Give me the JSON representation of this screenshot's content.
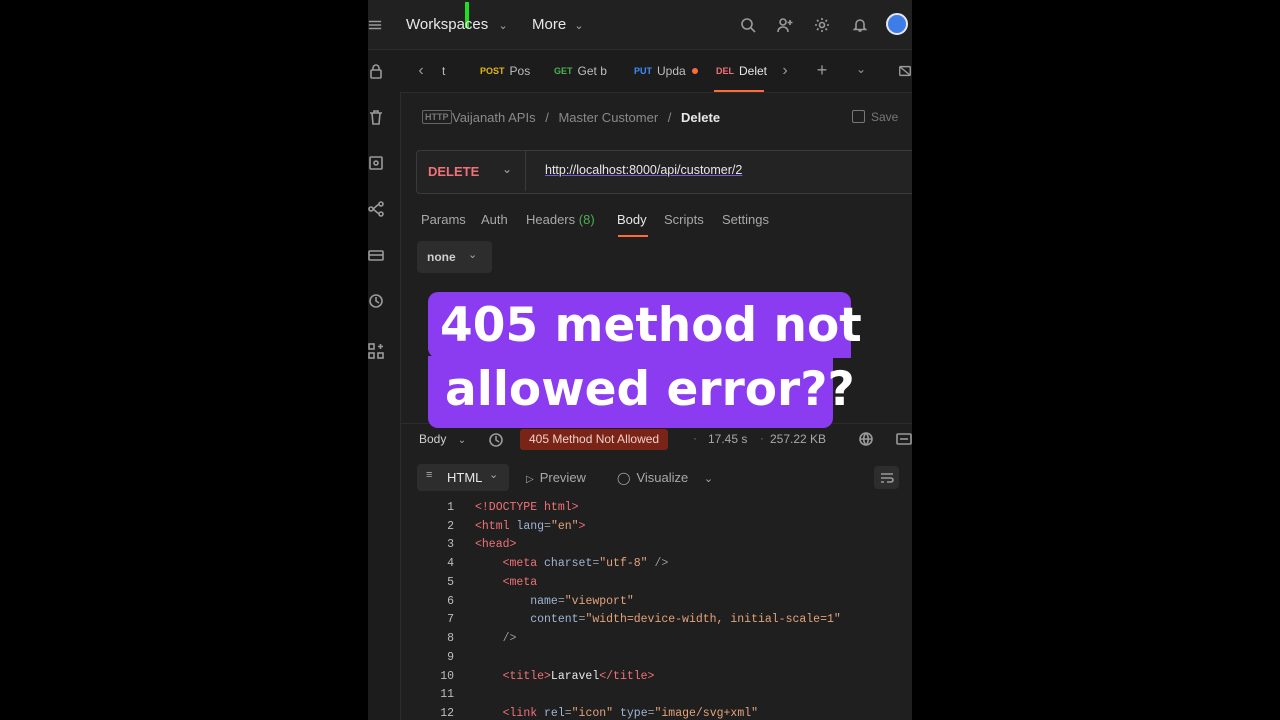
{
  "topbar": {
    "workspaces_label": "Workspaces",
    "more_label": "More"
  },
  "tabs": [
    {
      "method": "",
      "label": "t"
    },
    {
      "method": "POST",
      "label": "Pos"
    },
    {
      "method": "GET",
      "label": "Get b"
    },
    {
      "method": "PUT",
      "label": "Upda"
    },
    {
      "method": "DEL",
      "label": "Delet"
    }
  ],
  "breadcrumb": {
    "collection": "Vaijanath APIs",
    "folder": "Master Customer",
    "request": "Delete",
    "save_label": "Save"
  },
  "request": {
    "method": "DELETE",
    "url": "http://localhost:8000/api/customer/2"
  },
  "request_tabs": {
    "params": "Params",
    "auth": "Auth",
    "headers": "Headers",
    "headers_count": "(8)",
    "body": "Body",
    "scripts": "Scripts",
    "settings": "Settings"
  },
  "body_type": "none",
  "overlay": {
    "line1": "405 method not",
    "line2": "allowed error??"
  },
  "response": {
    "body_label": "Body",
    "status": "405 Method Not Allowed",
    "time": "17.45 s",
    "size": "257.22 KB",
    "format": "HTML",
    "preview_label": "Preview",
    "visualize_label": "Visualize"
  },
  "code_lines": [
    {
      "n": "1"
    },
    {
      "n": "2"
    },
    {
      "n": "3"
    },
    {
      "n": "4"
    },
    {
      "n": "5"
    },
    {
      "n": "6"
    },
    {
      "n": "7"
    },
    {
      "n": "8"
    },
    {
      "n": "9"
    },
    {
      "n": "10"
    },
    {
      "n": "11"
    },
    {
      "n": "12"
    }
  ],
  "code": {
    "l1": "<!DOCTYPE html>",
    "l2_open": "<html ",
    "l2_attr": "lang",
    "l2_str": "\"en\"",
    "l2_close": ">",
    "l3": "<head>",
    "l4_open": "<meta ",
    "l4_attr": "charset",
    "l4_str": "\"utf-8\"",
    "l4_close": " />",
    "l5": "<meta",
    "l6_attr": "name",
    "l6_str": "\"viewport\"",
    "l7_attr": "content",
    "l7_str": "\"width=device-width, initial-scale=1\"",
    "l8": "/>",
    "l10_open": "<title>",
    "l10_text": "Laravel",
    "l10_close": "</title>",
    "l12_open": "<link ",
    "l12_attr1": "rel",
    "l12_str1": "\"icon\"",
    "l12_attr2": "type",
    "l12_str2": "\"image/svg+xml\""
  },
  "colors": {
    "accent": "#ff6c37",
    "overlay": "#8b3cf0",
    "error_badge": "#b0301f",
    "green_marker": "#22dd22"
  }
}
